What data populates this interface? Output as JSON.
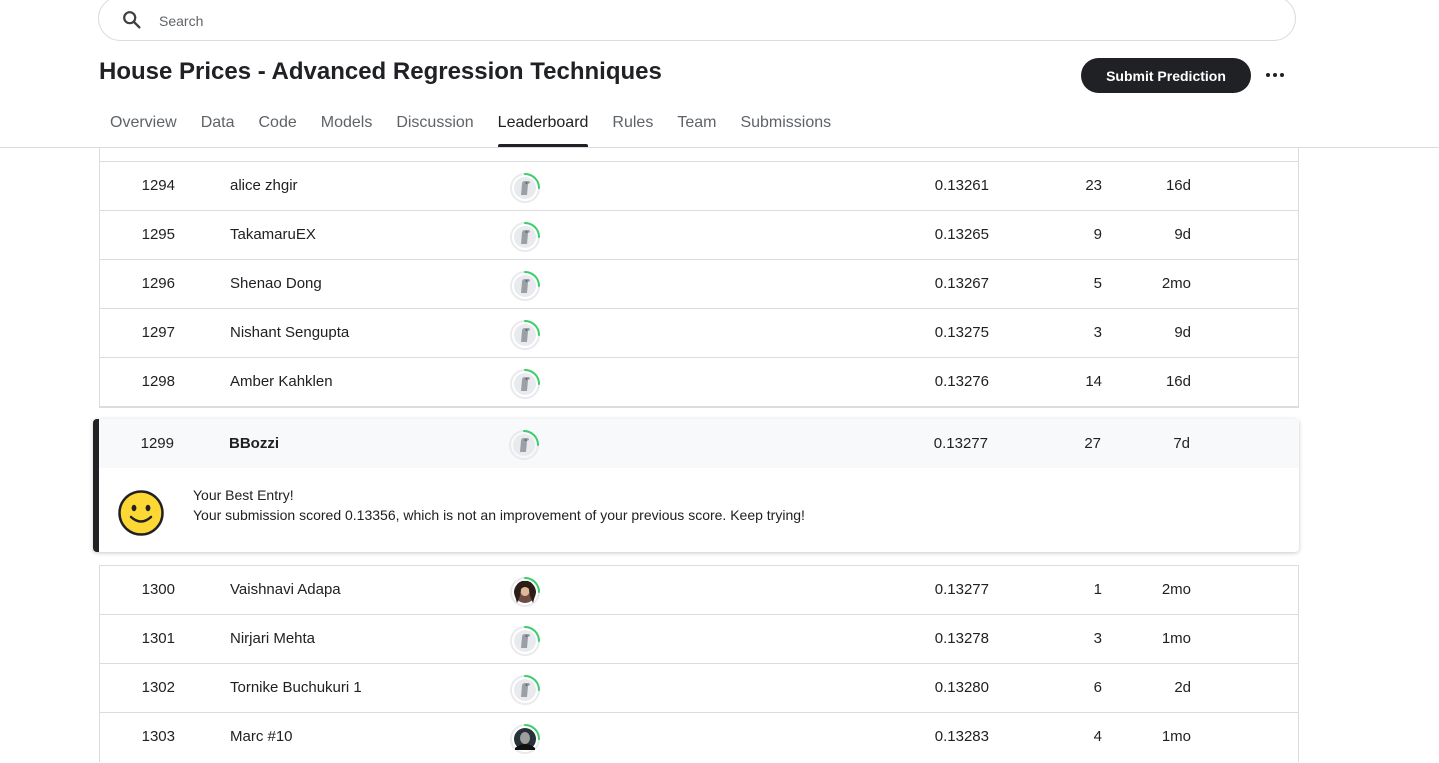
{
  "search": {
    "placeholder": "Search"
  },
  "competition": {
    "title": "House Prices - Advanced Regression Techniques"
  },
  "header": {
    "submit_label": "Submit Prediction",
    "more_icon": "more-horizontal-icon"
  },
  "tabs": [
    {
      "label": "Overview",
      "active": false
    },
    {
      "label": "Data",
      "active": false
    },
    {
      "label": "Code",
      "active": false
    },
    {
      "label": "Models",
      "active": false
    },
    {
      "label": "Discussion",
      "active": false
    },
    {
      "label": "Leaderboard",
      "active": true
    },
    {
      "label": "Rules",
      "active": false
    },
    {
      "label": "Team",
      "active": false
    },
    {
      "label": "Submissions",
      "active": false
    }
  ],
  "leaderboard": {
    "rows_before": [
      {
        "rank": "1294",
        "team": "alice zhgir",
        "score": "0.13261",
        "entries": "23",
        "last": "16d",
        "avatar": "default"
      },
      {
        "rank": "1295",
        "team": "TakamaruEX",
        "score": "0.13265",
        "entries": "9",
        "last": "9d",
        "avatar": "default"
      },
      {
        "rank": "1296",
        "team": "Shenao Dong",
        "score": "0.13267",
        "entries": "5",
        "last": "2mo",
        "avatar": "default"
      },
      {
        "rank": "1297",
        "team": "Nishant Sengupta",
        "score": "0.13275",
        "entries": "3",
        "last": "9d",
        "avatar": "default"
      },
      {
        "rank": "1298",
        "team": "Amber Kahklen",
        "score": "0.13276",
        "entries": "14",
        "last": "16d",
        "avatar": "default"
      }
    ],
    "my_row": {
      "rank": "1299",
      "team": "BBozzi",
      "score": "0.13277",
      "entries": "27",
      "last": "7d",
      "avatar": "default"
    },
    "message": {
      "title": "Your Best Entry!",
      "text": "Your submission scored 0.13356, which is not an improvement of your previous score. Keep trying!",
      "icon": "smiley-face-icon"
    },
    "rows_after": [
      {
        "rank": "1300",
        "team": "Vaishnavi Adapa",
        "score": "0.13277",
        "entries": "1",
        "last": "2mo",
        "avatar": "photo-woman"
      },
      {
        "rank": "1301",
        "team": "Nirjari Mehta",
        "score": "0.13278",
        "entries": "3",
        "last": "1mo",
        "avatar": "default"
      },
      {
        "rank": "1302",
        "team": "Tornike Buchukuri 1",
        "score": "0.13280",
        "entries": "6",
        "last": "2d",
        "avatar": "default"
      },
      {
        "rank": "1303",
        "team": "Marc #10",
        "score": "0.13283",
        "entries": "4",
        "last": "1mo",
        "avatar": "photo-dark"
      }
    ]
  },
  "colors": {
    "accent": "#202124",
    "progress_ring": "#20BEFF",
    "ring_green": "#3BCE6B",
    "border": "#dadce0"
  }
}
